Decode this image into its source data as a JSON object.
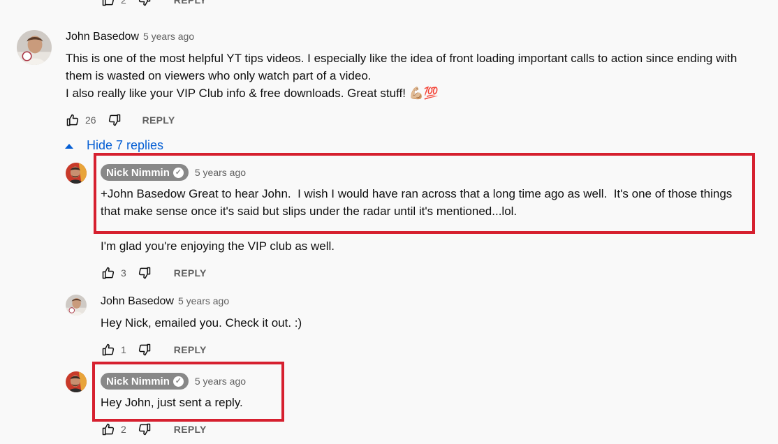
{
  "top_actions": {
    "like_count": "2",
    "reply_label": "REPLY"
  },
  "comment": {
    "author": "John Basedow",
    "time": "5 years ago",
    "text": "This is one of the most helpful YT tips videos. I especially like the idea of front loading important calls to action since ending with\nthem is wasted on viewers who only watch part of a video.\nI also really like your VIP Club info & free downloads. Great stuff! 💪🏼💯",
    "like_count": "26",
    "reply_label": "REPLY"
  },
  "replies_toggle": {
    "label": "Hide 7 replies"
  },
  "replies": [
    {
      "author": "Nick Nimmin",
      "time": "5 years ago",
      "text_highlighted": "+John Basedow Great to hear John.  I wish I would have ran across that a long time ago as well.  It's one of those things\nthat make sense once it's said but slips under the radar until it's mentioned...lol.",
      "text_more": "I'm glad you're enjoying the VIP club as well.",
      "like_count": "3",
      "reply_label": "REPLY"
    },
    {
      "author": "John Basedow",
      "time": "5 years ago",
      "text": "Hey Nick, emailed you. Check it out. :)",
      "like_count": "1",
      "reply_label": "REPLY"
    },
    {
      "author": "Nick Nimmin",
      "time": "5 years ago",
      "text": "Hey John, just sent a reply.",
      "like_count": "2",
      "reply_label": "REPLY"
    }
  ],
  "icons": {
    "like": "thumbs-up-icon",
    "dislike": "thumbs-down-icon",
    "collapse": "caret-up-icon",
    "verified": "check-circle-icon"
  },
  "colors": {
    "highlight": "#d6202f",
    "link": "#065fd4",
    "badge": "#888888"
  }
}
